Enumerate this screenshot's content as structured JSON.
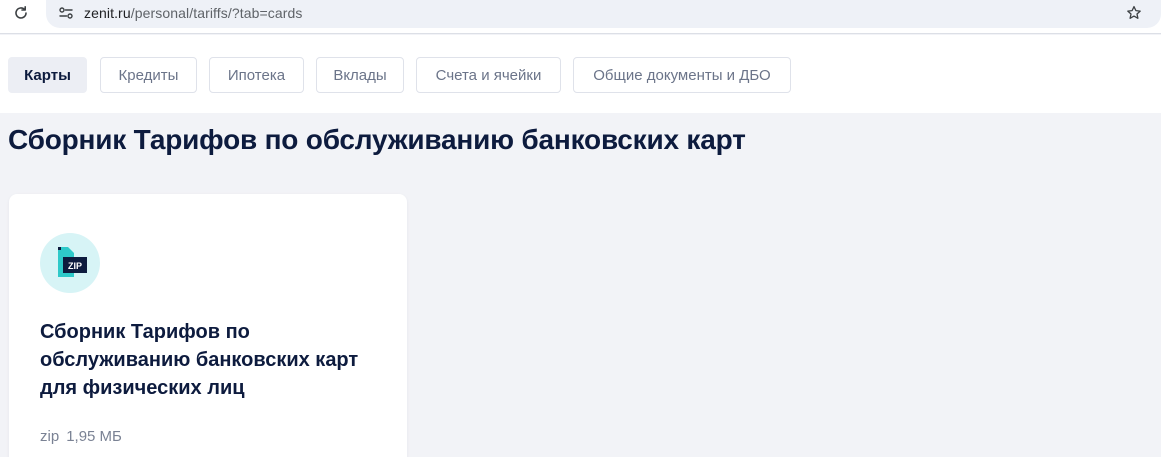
{
  "browser": {
    "url_host": "zenit.ru",
    "url_path": "/personal/tariffs/?tab=cards"
  },
  "tabs": [
    {
      "label": "Карты",
      "active": true
    },
    {
      "label": "Кредиты",
      "active": false
    },
    {
      "label": "Ипотека",
      "active": false
    },
    {
      "label": "Вклады",
      "active": false
    },
    {
      "label": "Счета и ячейки",
      "active": false
    },
    {
      "label": "Общие документы и ДБО",
      "active": false
    }
  ],
  "page_title": "Сборник Тарифов по обслуживанию банковских карт",
  "document": {
    "title": "Сборник Тарифов по обслуживанию банковских карт для физических лиц",
    "badge": "ZIP",
    "file_type": "zip",
    "file_size": "1,95 МБ"
  },
  "colors": {
    "accent_teal": "#2ec9c9",
    "icon_bg": "#d7f4f6",
    "text_dark": "#0d1b3e",
    "text_muted": "#7a8294"
  }
}
